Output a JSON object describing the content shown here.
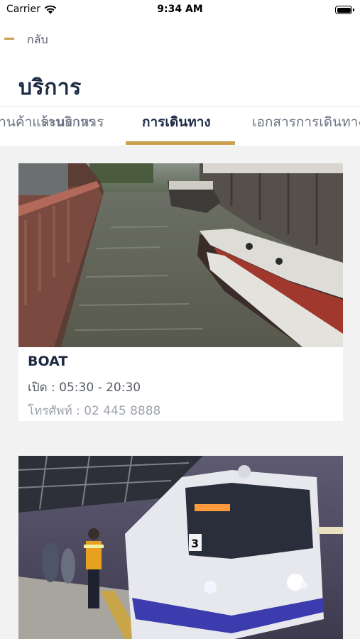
{
  "status_bar": {
    "carrier": "Carrier",
    "time": "9:34 AM"
  },
  "nav": {
    "back_label": "กลับ"
  },
  "page": {
    "title": "บริการ"
  },
  "tabs": [
    {
      "label": "ร้านค้าและบริการ"
    },
    {
      "label": "ร้านอาหาร"
    },
    {
      "label": "การเดินทาง",
      "active": true
    },
    {
      "label": "เอกสารการเดินทาง"
    }
  ],
  "services": [
    {
      "name": "BOAT",
      "hours": "เปิด : 05:30 - 20:30",
      "phone": "โทรศัพท์ : 02 445 8888",
      "photo_icon": "canal-boat-photo"
    },
    {
      "name": "",
      "photo_icon": "airport-rail-link-train-photo"
    }
  ],
  "colors": {
    "accent": "#c8a04e",
    "title": "#1c2a44",
    "background": "#f2f2f2"
  }
}
